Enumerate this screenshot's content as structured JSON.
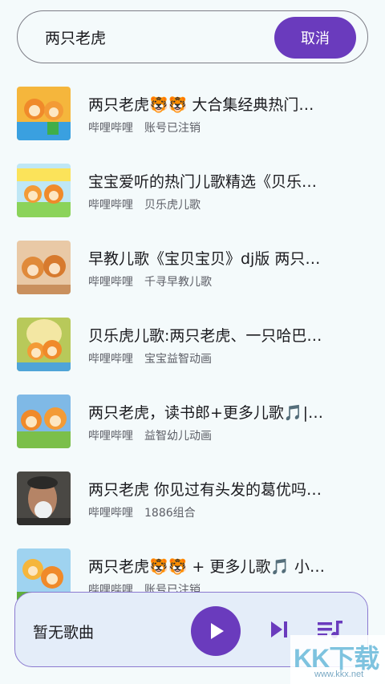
{
  "search": {
    "query": "两只老虎",
    "cancel_label": "取消"
  },
  "results": [
    {
      "title": "两只老虎🐯🐯 大合集经典热门…",
      "source": "哔哩哔哩",
      "uploader": "账号已注销"
    },
    {
      "title": "宝宝爱听的热门儿歌精选《贝乐…",
      "source": "哔哩哔哩",
      "uploader": "贝乐虎儿歌"
    },
    {
      "title": "早教儿歌《宝贝宝贝》dj版 两只…",
      "source": "哔哩哔哩",
      "uploader": "千寻早教儿歌"
    },
    {
      "title": "贝乐虎儿歌:两只老虎、一只哈巴…",
      "source": "哔哩哔哩",
      "uploader": "宝宝益智动画"
    },
    {
      "title": "两只老虎，读书郎+更多儿歌🎵|…",
      "source": "哔哩哔哩",
      "uploader": "益智幼儿动画"
    },
    {
      "title": "两只老虎 你见过有头发的葛优吗…",
      "source": "哔哩哔哩",
      "uploader": "1886组合"
    },
    {
      "title": "两只老虎🐯🐯 + 更多儿歌🎵 小…",
      "source": "哔哩哔哩",
      "uploader": "账号已注销"
    }
  ],
  "player": {
    "now_playing": "暂无歌曲"
  },
  "watermark": {
    "logo": "KK下载",
    "url": "www.kkx.net"
  },
  "colors": {
    "accent": "#6a3bbd",
    "background": "#f4fafb",
    "player_bg": "#e4edf9"
  }
}
